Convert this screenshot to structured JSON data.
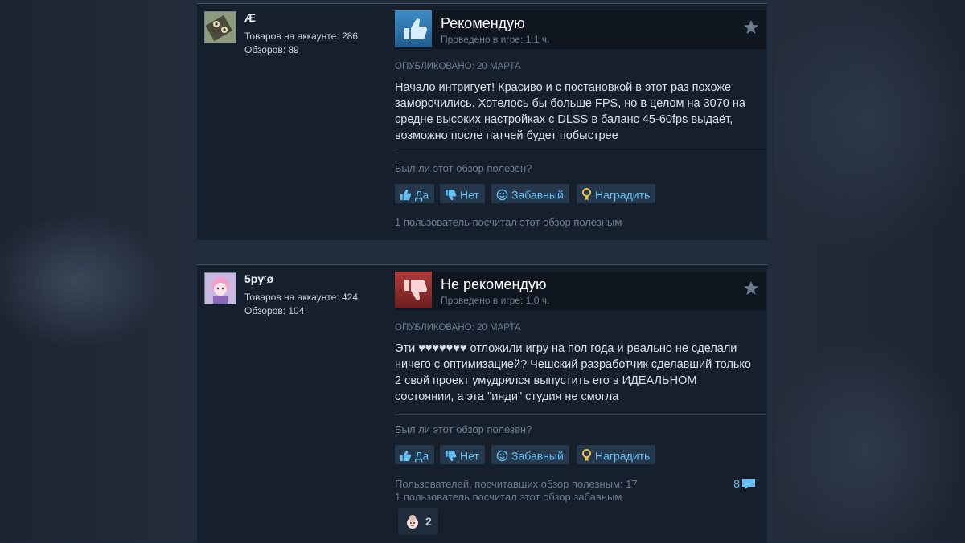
{
  "reviews": [
    {
      "username": "Æ",
      "products_label": "Товаров на аккаунте: 286",
      "reviews_label": "Обзоров: 89",
      "recommendation": "Рекомендую",
      "recommended": true,
      "hours": "Проведено в игре: 1.1 ч.",
      "posted": "ОПУБЛИКОВАНО: 20 МАРТА",
      "text": "Начало интригует! Красиво и с постановкой в этот раз похоже заморочились. Хотелось бы больше FPS, но в целом на 3070 на средне высоких настройках с DLSS в баланс 45-60fps выдаёт, возможно после патчей будет побыстрее",
      "helpful_question": "Был ли этот обзор полезен?",
      "buttons": {
        "yes": "Да",
        "no": "Нет",
        "funny": "Забавный",
        "award": "Наградить"
      },
      "footnote_1": "1 пользователь посчитал этот обзор полезным"
    },
    {
      "username": "5pγʳø",
      "products_label": "Товаров на аккаунте: 424",
      "reviews_label": "Обзоров: 104",
      "recommendation": "Не рекомендую",
      "recommended": false,
      "hours": "Проведено в игре: 1.0 ч.",
      "posted": "ОПУБЛИКОВАНО: 20 МАРТА",
      "text": "Эти ♥♥♥♥♥♥♥ отложили игру на пол года и реально не сделали ничего с оптимизацией? Чешский разработчик сделавший только 2 свой проект умудрился выпустить его в ИДЕАЛЬНОМ состоянии, а эта \"инди\" студия не смогла",
      "helpful_question": "Был ли этот обзор полезен?",
      "buttons": {
        "yes": "Да",
        "no": "Нет",
        "funny": "Забавный",
        "award": "Наградить"
      },
      "footnote_1": "Пользователей, посчитавших обзор полезным: 17",
      "footnote_2": "1 пользователь посчитал этот обзор забавным",
      "comments": "8",
      "award_count": "2"
    }
  ],
  "icons": {
    "thumb_up": "thumbs-up-icon",
    "thumb_down": "thumbs-down-icon",
    "star": "star-icon",
    "smile": "smile-icon",
    "award": "award-icon",
    "comment": "comment-bubble-icon"
  },
  "colors": {
    "link_blue": "#66c0f4",
    "positive": "#3d8dc7",
    "negative": "#b23c3c"
  }
}
